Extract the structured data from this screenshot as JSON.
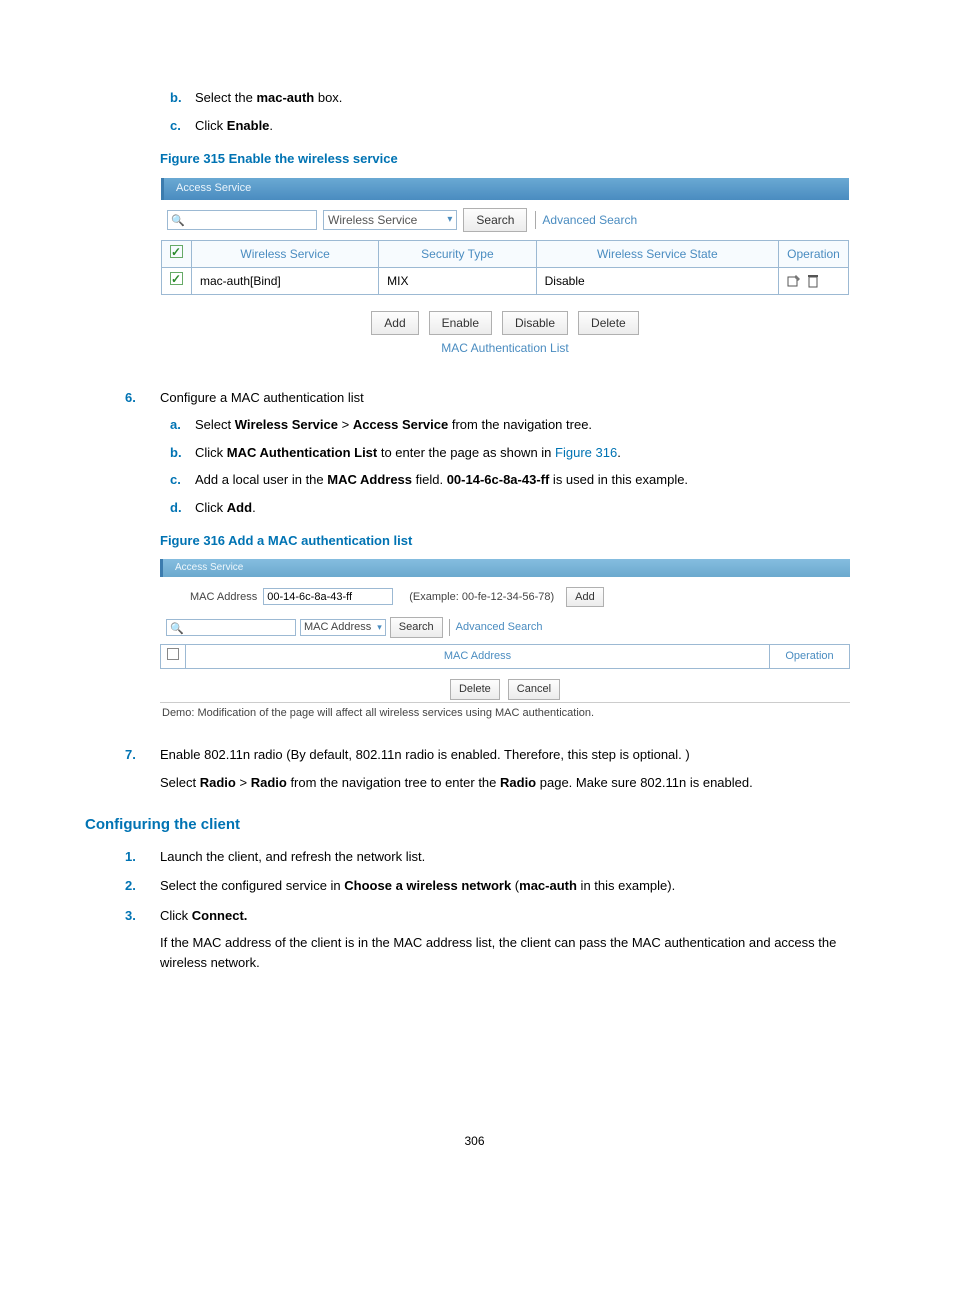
{
  "steps_top": {
    "b": {
      "pre": "Select the ",
      "bold": "mac-auth",
      "post": " box."
    },
    "c": {
      "pre": "Click ",
      "bold": "Enable",
      "post": "."
    }
  },
  "fig315": {
    "caption": "Figure 315 Enable the wireless service",
    "tab": "Access Service",
    "select_label": "Wireless Service",
    "search_btn": "Search",
    "advanced": "Advanced Search",
    "headers": {
      "wireless_service": "Wireless Service",
      "security_type": "Security Type",
      "state": "Wireless Service State",
      "operation": "Operation"
    },
    "row": {
      "name": "mac-auth[Bind]",
      "sec": "MIX",
      "state": "Disable"
    },
    "buttons": {
      "add": "Add",
      "enable": "Enable",
      "disable": "Disable",
      "delete": "Delete"
    },
    "mac_list_link": "MAC Authentication List"
  },
  "step6": {
    "title": "Configure a MAC authentication list",
    "a": {
      "pre": "Select ",
      "b1": "Wireless Service",
      "mid": " > ",
      "b2": "Access Service",
      "post": " from the navigation tree."
    },
    "b": {
      "pre": "Click ",
      "b1": "MAC Authentication List",
      "mid": " to enter the page as shown in ",
      "link": "Figure 316",
      "post": "."
    },
    "c": {
      "pre": "Add a local user in the ",
      "b1": "MAC Address",
      "mid": " field. ",
      "b2": "00-14-6c-8a-43-ff",
      "post": " is used in this example."
    },
    "d": {
      "pre": "Click ",
      "b1": "Add",
      "post": "."
    }
  },
  "fig316": {
    "caption": "Figure 316 Add a MAC authentication list",
    "tab": "Access Service",
    "mac_label": "MAC Address",
    "mac_value": "00-14-6c-8a-43-ff",
    "example": "(Example: 00-fe-12-34-56-78)",
    "add_btn": "Add",
    "select_label": "MAC Address",
    "search_btn": "Search",
    "advanced": "Advanced Search",
    "headers": {
      "mac": "MAC Address",
      "operation": "Operation"
    },
    "delete_btn": "Delete",
    "cancel_btn": "Cancel",
    "demo": "Demo: Modification of the page will affect all wireless services using MAC authentication."
  },
  "step7": {
    "line1": "Enable 802.11n radio (By default, 802.11n radio is enabled. Therefore, this step is optional. )",
    "line2_pre": "Select ",
    "b1": "Radio",
    "mid1": " > ",
    "b2": "Radio",
    "mid2": " from the navigation tree to enter the ",
    "b3": "Radio",
    "post": " page. Make sure 802.11n is enabled."
  },
  "client": {
    "heading": "Configuring the client",
    "s1": "Launch the client, and refresh the network list.",
    "s2_pre": "Select the configured service in ",
    "s2_b1": "Choose a wireless network",
    "s2_mid": " (",
    "s2_b2": "mac-auth",
    "s2_post": " in this example).",
    "s3_pre": "Click ",
    "s3_b": "Connect.",
    "s3_body": "If the MAC address of the client is in the MAC address list, the client can pass the MAC authentication and access the wireless network."
  },
  "page_number": "306"
}
